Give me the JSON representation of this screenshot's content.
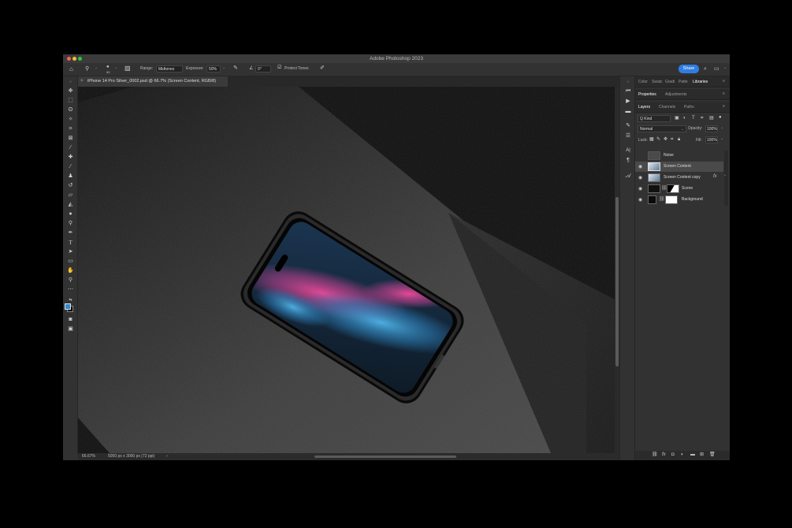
{
  "window": {
    "title": "Adobe Photoshop 2023"
  },
  "options_bar": {
    "range_label": "Range:",
    "range_value": "Midtones",
    "exposure_label": "Exposure:",
    "exposure_value": "50%",
    "angle_value": "0°",
    "protect_tones_label": "Protect Tones",
    "brush_size": "65",
    "share_label": "Share"
  },
  "document": {
    "tab_title": "iPhone 14 Pro Silver_0002.psd @ 66.7% (Screen Content, RGB/8)",
    "close_glyph": "×"
  },
  "status": {
    "zoom": "66.67%",
    "dimensions": "5000 px x 3000 px (72 ppi)",
    "arrow": "›"
  },
  "panels": {
    "top_tabs": [
      "Color",
      "Swatc",
      "Gradi",
      "Patte",
      "Libraries"
    ],
    "mid_tabs": [
      "Properties",
      "Adjustments"
    ],
    "layer_tabs": [
      "Layers",
      "Channels",
      "Paths"
    ],
    "kind_label": "Q Kind",
    "blend_mode": "Normal",
    "opacity_label": "Opacity:",
    "opacity_value": "100%",
    "lock_label": "Lock:",
    "fill_label": "Fill:",
    "fill_value": "100%",
    "fx_label": "fx"
  },
  "layers": [
    {
      "name": "Noise",
      "selected": false,
      "visible": false
    },
    {
      "name": "Screen Content",
      "selected": true,
      "visible": true
    },
    {
      "name": "Screen Content copy",
      "selected": false,
      "visible": true
    },
    {
      "name": "Scene",
      "selected": false,
      "visible": true
    },
    {
      "name": "Background",
      "selected": false,
      "visible": true
    }
  ],
  "colors": {
    "foreground": "#2f8bd6",
    "background": "#000000",
    "accent": "#2f7de1"
  }
}
